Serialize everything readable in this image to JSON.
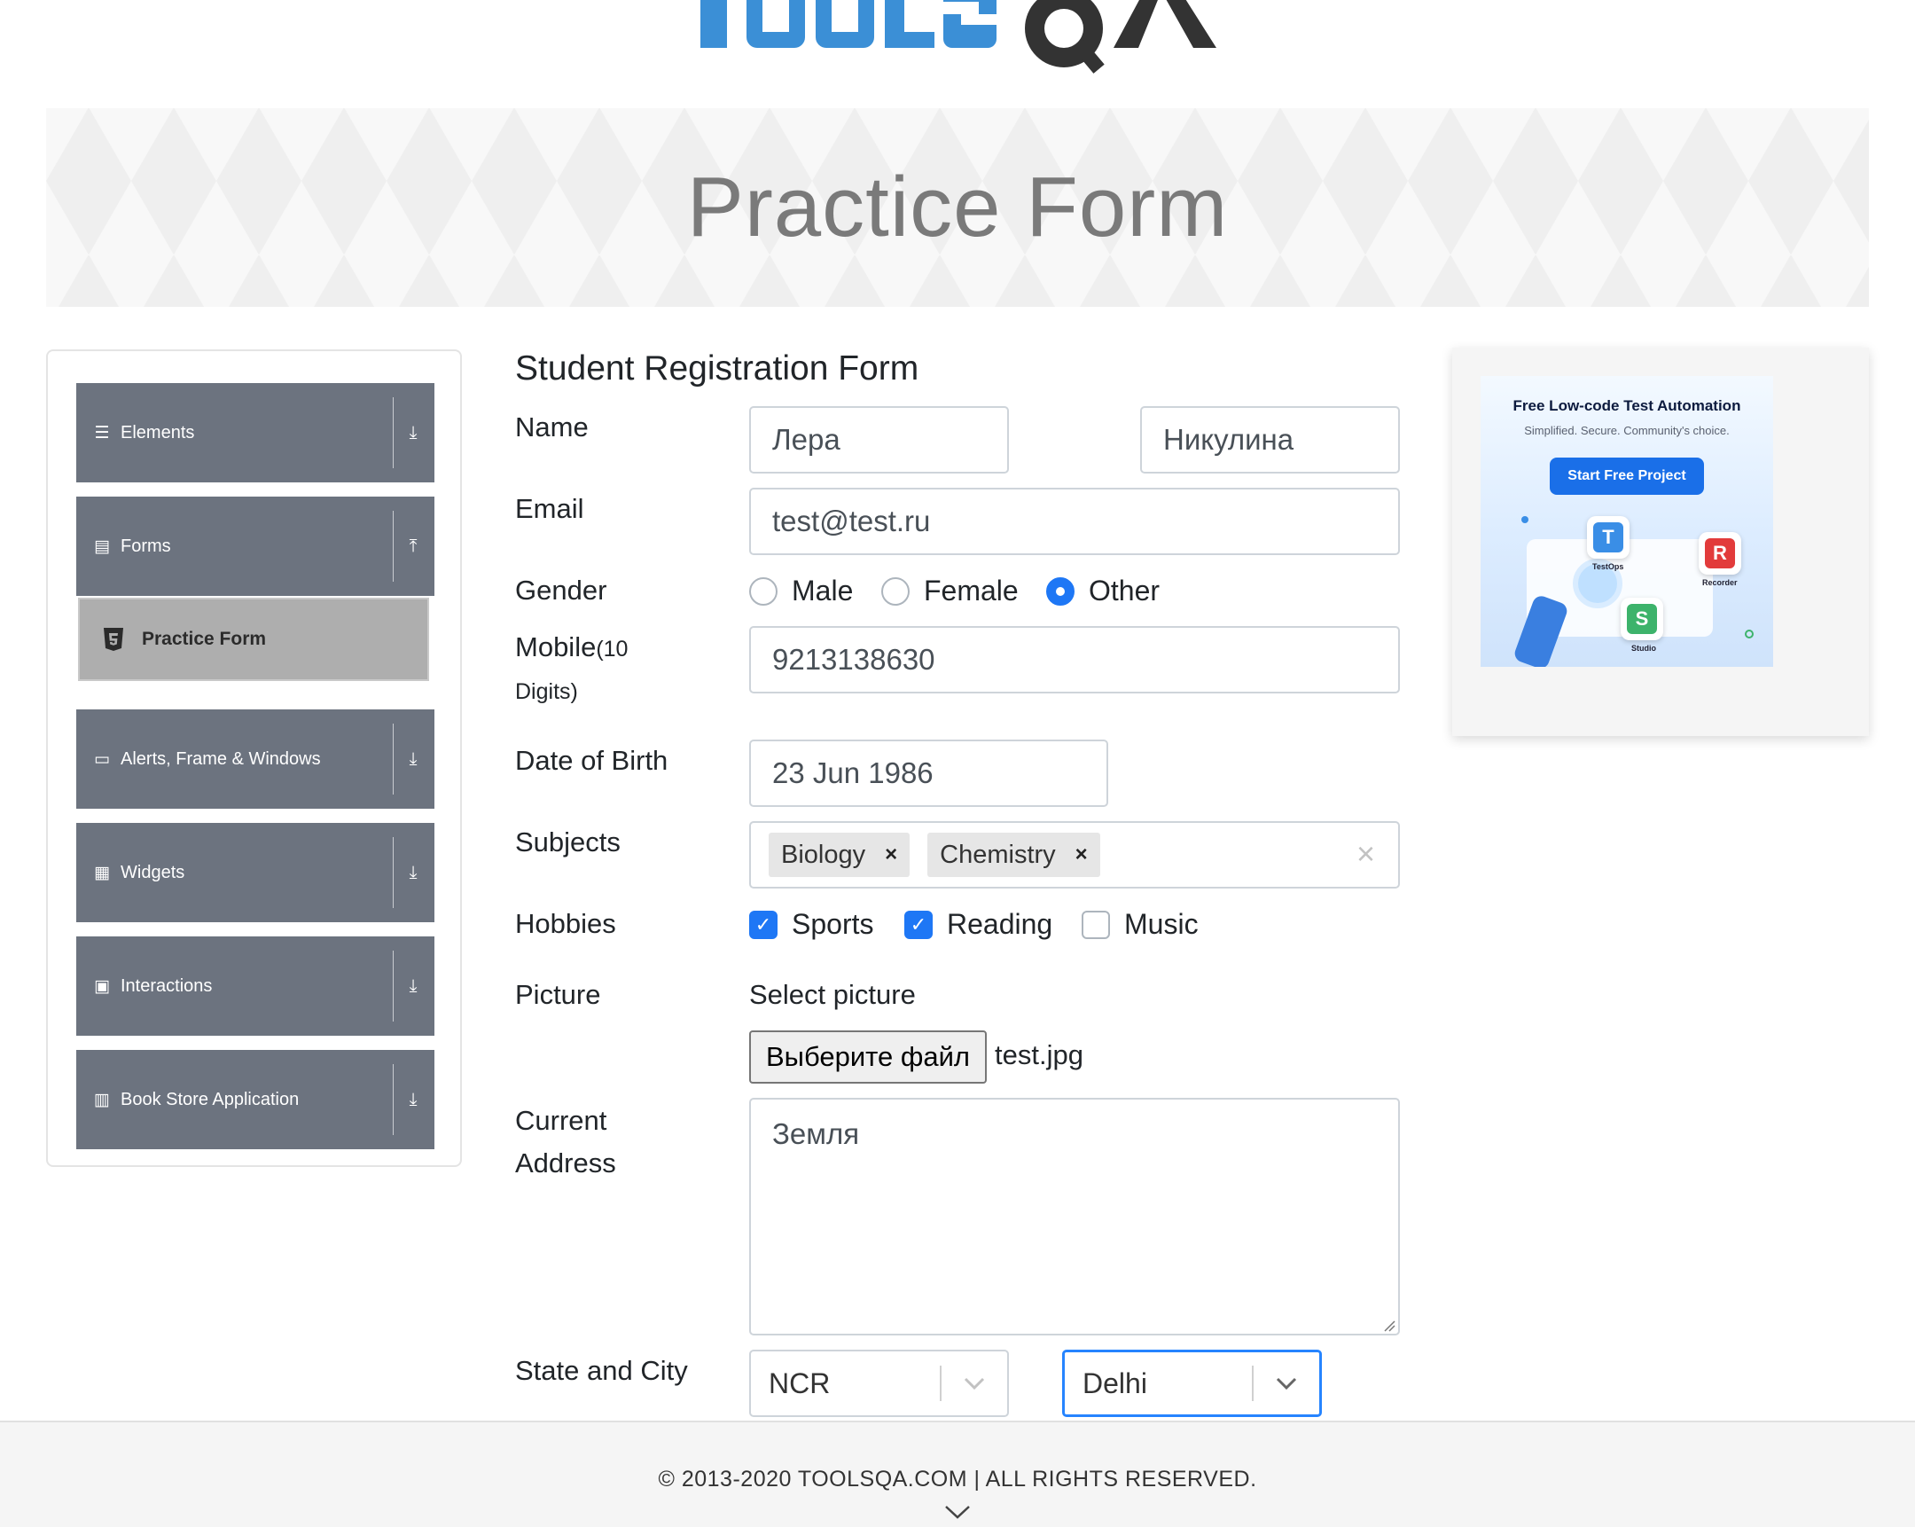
{
  "logo": {
    "alt": "TOOLSQA"
  },
  "banner": {
    "title": "Practice Form"
  },
  "sidebar": {
    "groups": [
      {
        "label": "Elements",
        "icon": "hamburger-icon"
      },
      {
        "label": "Forms",
        "icon": "form-doc-icon",
        "expanded": true
      },
      {
        "label": "Alerts, Frame & Windows",
        "icon": "window-icon"
      },
      {
        "label": "Widgets",
        "icon": "widgets-grid-icon"
      },
      {
        "label": "Interactions",
        "icon": "interactions-icon"
      },
      {
        "label": "Book Store Application",
        "icon": "books-icon"
      }
    ],
    "active_item": {
      "label": "Practice Form",
      "icon": "html5-shield-icon"
    }
  },
  "form": {
    "title": "Student Registration Form",
    "name_label": "Name",
    "first_name": "Лера",
    "last_name": "Никулина",
    "email_label": "Email",
    "email": "test@test.ru",
    "gender_label": "Gender",
    "genders": [
      {
        "label": "Male",
        "selected": false
      },
      {
        "label": "Female",
        "selected": false
      },
      {
        "label": "Other",
        "selected": true
      }
    ],
    "mobile_label": "Mobile",
    "mobile_hint_a": "(10",
    "mobile_hint_b": "Digits)",
    "mobile": "9213138630",
    "dob_label": "Date of Birth",
    "dob": "23 Jun 1986",
    "subjects_label": "Subjects",
    "subjects": [
      "Biology",
      "Chemistry"
    ],
    "hobbies_label": "Hobbies",
    "hobbies": [
      {
        "label": "Sports",
        "checked": true
      },
      {
        "label": "Reading",
        "checked": true
      },
      {
        "label": "Music",
        "checked": false
      }
    ],
    "picture_label": "Picture",
    "select_picture": "Select picture",
    "file_button": "Выберите файл",
    "file_name": "test.jpg",
    "address_label_a": "Current",
    "address_label_b": "Address",
    "address": "Земля",
    "state_city_label": "State and City",
    "state": "NCR",
    "city": "Delhi"
  },
  "ad": {
    "title": "Free Low-code Test Automation",
    "subtitle": "Simplified. Secure. Community's choice.",
    "button": "Start Free Project",
    "tiles": [
      {
        "letter": "T",
        "caption": "TestOps",
        "color": "#3a8ee6"
      },
      {
        "letter": "R",
        "caption": "Recorder",
        "color": "#e23b3b"
      },
      {
        "letter": "S",
        "caption": "Studio",
        "color": "#3db36b"
      }
    ]
  },
  "footer": {
    "text": "© 2013-2020 TOOLSQA.COM | ALL RIGHTS RESERVED."
  },
  "colors": {
    "accent": "#1e77f5",
    "sidebar": "#6c737f",
    "active_item": "#aeaeae",
    "logo_blue": "#3b8fd6"
  }
}
